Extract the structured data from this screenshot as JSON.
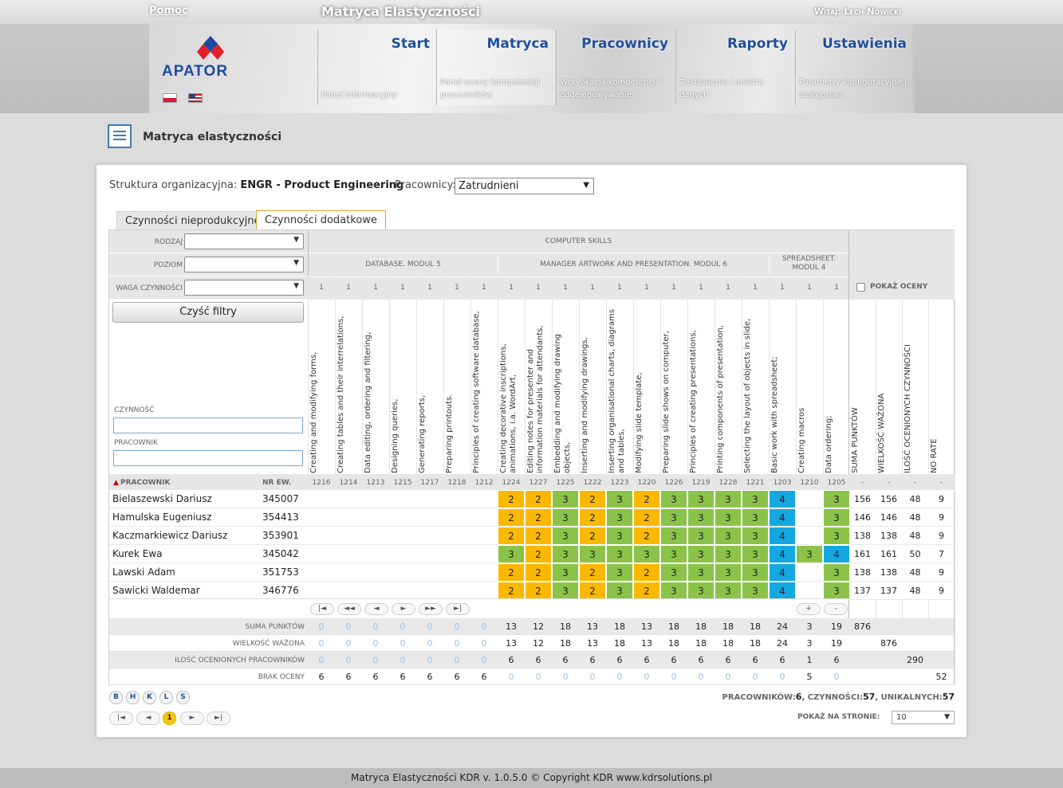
{
  "header": {
    "help": "Pomoc",
    "title": "Matryca Elastyczności",
    "welcome": "Witaj: Lech Nowicki",
    "logo": "APATOR"
  },
  "nav": [
    {
      "title": "Start",
      "desc": "Panel informacyjny"
    },
    {
      "title": "Matryca",
      "desc": "Panel oceny kompetencji pracowników"
    },
    {
      "title": "Pracownicy",
      "desc": "Weryfikacja kompetencji i oddelegowywanie"
    },
    {
      "title": "Raporty",
      "desc": "Zestawienia i analiza danych"
    },
    {
      "title": "Ustawienia",
      "desc": "Parametry konfiguracyjne i zastępstwa"
    }
  ],
  "page": {
    "title": "Matryca elastyczności",
    "org_label": "Struktura organizacyjna:",
    "org_value": "ENGR - Product Engineering",
    "emp_label": "Pracownicy:",
    "emp_value": "Zatrudnieni"
  },
  "tabs": [
    "Czynności nieprodukcyjne",
    "Czynności dodatkowe"
  ],
  "filters": {
    "rodzaj": "RODZAJ",
    "poziom": "POZIOM",
    "waga": "WAGA CZYNNOŚCI",
    "clear": "Czyść filtry",
    "czynnosc": "CZYNNOŚĆ",
    "pracownik": "PRACOWNIK"
  },
  "groups": {
    "top": "COMPUTER SKILLS",
    "g1": "DATABASE. MODUL 5",
    "g2": "MANAGER ARTWORK AND PRESENTATION. MODUL 6",
    "g3": "SPREADSHEET. MODUL 4",
    "show": "POKAŻ OCENY"
  },
  "activities": [
    {
      "name": "Creating and modifying forms,",
      "id": "1216"
    },
    {
      "name": "Creating tables and their interrelations,",
      "id": "1214"
    },
    {
      "name": "Data editing, ordering and filtering,",
      "id": "1213"
    },
    {
      "name": "Designing queries,",
      "id": "1215"
    },
    {
      "name": "Generating reports,",
      "id": "1217"
    },
    {
      "name": "Preparing printouts.",
      "id": "1218"
    },
    {
      "name": "Principles of creating software database,",
      "id": "1212"
    },
    {
      "name": "Creating decorative inscriptions, animations, i.a. WordArt,",
      "id": "1224"
    },
    {
      "name": "Editing notes for presenter and information materials for attendants,",
      "id": "1227"
    },
    {
      "name": "Embedding and modifying drawing objects,",
      "id": "1225"
    },
    {
      "name": "Inserting and modifying drawings,",
      "id": "1222"
    },
    {
      "name": "Inserting organisational charts, diagrams and tables,",
      "id": "1223"
    },
    {
      "name": "Modifying slide template,",
      "id": "1220"
    },
    {
      "name": "Preparing slide shows on computer,",
      "id": "1226"
    },
    {
      "name": "Principles of creating presentations,",
      "id": "1219"
    },
    {
      "name": "Printing components of presentation,",
      "id": "1228"
    },
    {
      "name": "Selecting the layout of objects in slide,",
      "id": "1221"
    },
    {
      "name": "Basic work with spreadsheet;",
      "id": "1203"
    },
    {
      "name": "Creating macros",
      "id": "1210"
    },
    {
      "name": "Data ordering;",
      "id": "1205"
    }
  ],
  "weight": "1",
  "summary_cols": [
    "SUMA PUNKTÓW",
    "WIELKOŚĆ WAŻONA",
    "ILOŚĆ OCENIONYCH CZYNNOŚCI",
    "NO RATE"
  ],
  "col_headers": {
    "employee": "PRACOWNIK",
    "nr": "NR EW.",
    "dash": "-"
  },
  "employees": [
    {
      "name": "Bielaszewski Dariusz",
      "nr": "345007",
      "r": [
        "",
        "",
        "",
        "",
        "",
        "",
        "",
        "2",
        "2",
        "3",
        "2",
        "3",
        "2",
        "3",
        "3",
        "3",
        "3",
        "4",
        "",
        "3"
      ],
      "s": [
        "156",
        "156",
        "48",
        "9"
      ]
    },
    {
      "name": "Hamulska Eugeniusz",
      "nr": "354413",
      "r": [
        "",
        "",
        "",
        "",
        "",
        "",
        "",
        "2",
        "2",
        "3",
        "2",
        "3",
        "2",
        "3",
        "3",
        "3",
        "3",
        "4",
        "",
        "3"
      ],
      "s": [
        "146",
        "146",
        "48",
        "9"
      ]
    },
    {
      "name": "Kaczmarkiewicz Dariusz",
      "nr": "353901",
      "r": [
        "",
        "",
        "",
        "",
        "",
        "",
        "",
        "2",
        "2",
        "3",
        "2",
        "3",
        "2",
        "3",
        "3",
        "3",
        "3",
        "4",
        "",
        "3"
      ],
      "s": [
        "138",
        "138",
        "48",
        "9"
      ]
    },
    {
      "name": "Kurek Ewa",
      "nr": "345042",
      "r": [
        "",
        "",
        "",
        "",
        "",
        "",
        "",
        "3",
        "2",
        "3",
        "3",
        "3",
        "3",
        "3",
        "3",
        "3",
        "3",
        "4",
        "3",
        "4"
      ],
      "s": [
        "161",
        "161",
        "50",
        "7"
      ]
    },
    {
      "name": "Lawski Adam",
      "nr": "351753",
      "r": [
        "",
        "",
        "",
        "",
        "",
        "",
        "",
        "2",
        "2",
        "3",
        "2",
        "3",
        "2",
        "3",
        "3",
        "3",
        "3",
        "4",
        "",
        "3"
      ],
      "s": [
        "138",
        "138",
        "48",
        "9"
      ]
    },
    {
      "name": "Sawicki Waldemar",
      "nr": "346776",
      "r": [
        "",
        "",
        "",
        "",
        "",
        "",
        "",
        "2",
        "2",
        "3",
        "2",
        "3",
        "2",
        "3",
        "3",
        "3",
        "3",
        "4",
        "",
        "3"
      ],
      "s": [
        "137",
        "137",
        "48",
        "9"
      ]
    }
  ],
  "pager": [
    "|◄",
    "◄◄",
    "◄",
    "►",
    "►►",
    "►|"
  ],
  "plusminus": [
    "+",
    "-"
  ],
  "totals": [
    {
      "label": "SUMA PUNKTÓW",
      "vals": [
        "0",
        "0",
        "0",
        "0",
        "0",
        "0",
        "0",
        "13",
        "12",
        "18",
        "13",
        "18",
        "13",
        "18",
        "18",
        "18",
        "18",
        "24",
        "3",
        "19"
      ],
      "extra": [
        "876",
        "",
        "",
        ""
      ]
    },
    {
      "label": "WIELKOŚĆ WAŻONA",
      "vals": [
        "0",
        "0",
        "0",
        "0",
        "0",
        "0",
        "0",
        "13",
        "12",
        "18",
        "13",
        "18",
        "13",
        "18",
        "18",
        "18",
        "18",
        "24",
        "3",
        "19"
      ],
      "extra": [
        "",
        "876",
        "",
        ""
      ]
    },
    {
      "label": "ILOŚĆ OCENIONYCH PRACOWNIKÓW",
      "vals": [
        "0",
        "0",
        "0",
        "0",
        "0",
        "0",
        "0",
        "6",
        "6",
        "6",
        "6",
        "6",
        "6",
        "6",
        "6",
        "6",
        "6",
        "6",
        "1",
        "6"
      ],
      "extra": [
        "",
        "",
        "290",
        ""
      ]
    },
    {
      "label": "BRAK OCENY",
      "vals": [
        "6",
        "6",
        "6",
        "6",
        "6",
        "6",
        "6",
        "0",
        "0",
        "0",
        "0",
        "0",
        "0",
        "0",
        "0",
        "0",
        "0",
        "0",
        "5",
        "0"
      ],
      "extra": [
        "",
        "",
        "",
        "52"
      ]
    }
  ],
  "letters": [
    "B",
    "H",
    "K",
    "L",
    "S"
  ],
  "bottom_pager": [
    "|◄",
    "◄",
    "1",
    "►",
    "►|"
  ],
  "stats": {
    "text1": "PRACOWNIKÓW:",
    "v1": "6",
    "text2": ", CZYNNOŚCI:",
    "v2": "57",
    "text3": ", UNIKALNYCH:",
    "v3": "57"
  },
  "perpage": {
    "label": "POKAŻ NA STRONIE:",
    "value": "10"
  },
  "footer": "Matryca Elastyczności KDR v. 1.0.5.0     © Copyright KDR www.kdrsolutions.pl",
  "colors": {
    "orange": "#fbb800",
    "green": "#8bc34a",
    "blue": "#15a8e0"
  }
}
